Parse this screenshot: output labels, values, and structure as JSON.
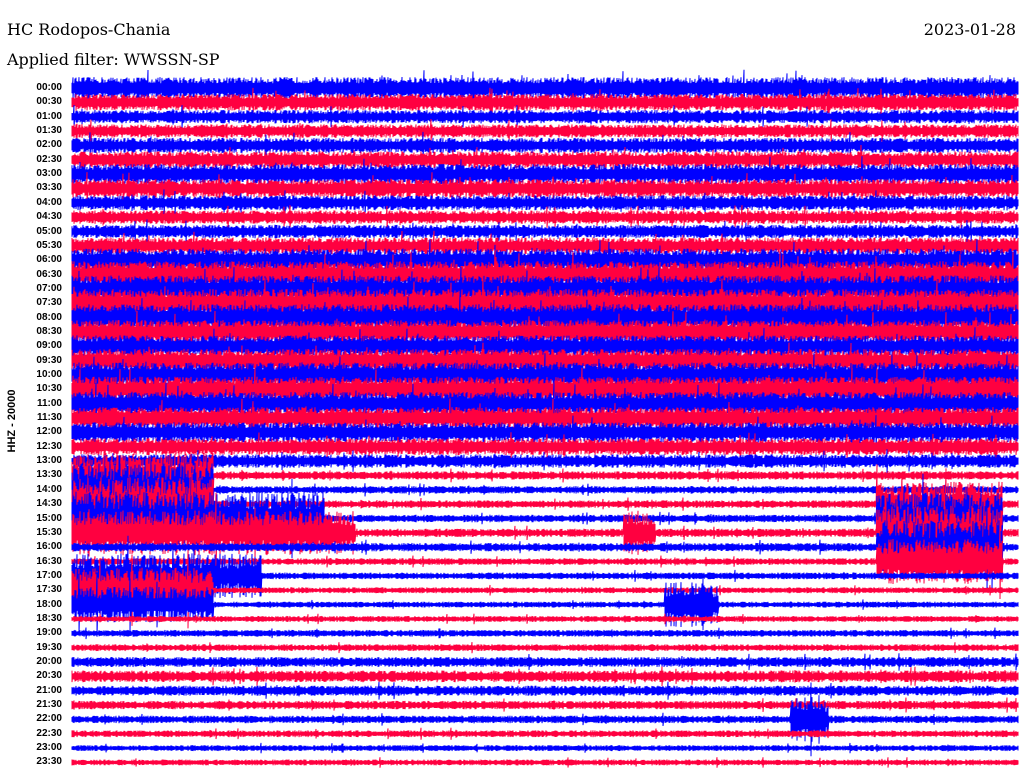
{
  "header": {
    "station": "HC Rodopos-Chania",
    "date": "2023-01-28",
    "filter": "Applied filter: WWSSN-SP"
  },
  "chart_data": {
    "type": "line",
    "title": "HC Rodopos-Chania",
    "ylabel": "HHZ - 20000",
    "xlabel": "",
    "minutes_per_row": 30,
    "series_colors": [
      "#0000ff",
      "#ff0040"
    ],
    "row_labels": [
      "00:00",
      "00:30",
      "01:00",
      "01:30",
      "02:00",
      "02:30",
      "03:00",
      "03:30",
      "04:00",
      "04:30",
      "05:00",
      "05:30",
      "06:00",
      "06:30",
      "07:00",
      "07:30",
      "08:00",
      "08:30",
      "09:00",
      "09:30",
      "10:00",
      "10:30",
      "11:00",
      "11:30",
      "12:00",
      "12:30",
      "13:00",
      "13:30",
      "14:00",
      "14:30",
      "15:00",
      "15:30",
      "16:00",
      "16:30",
      "17:00",
      "17:30",
      "18:00",
      "18:30",
      "19:00",
      "19:30",
      "20:00",
      "20:30",
      "21:00",
      "21:30",
      "22:00",
      "22:30",
      "23:00",
      "23:30"
    ],
    "row_noise_amplitude": [
      1.3,
      1.0,
      0.8,
      0.8,
      0.9,
      1.0,
      1.2,
      1.1,
      0.9,
      0.8,
      0.8,
      1.0,
      1.4,
      1.6,
      1.6,
      1.7,
      1.6,
      1.4,
      1.3,
      1.4,
      1.5,
      1.5,
      1.4,
      1.3,
      1.2,
      1.0,
      0.8,
      0.5,
      0.45,
      0.45,
      0.45,
      0.5,
      0.5,
      0.4,
      0.4,
      0.35,
      0.35,
      0.35,
      0.4,
      0.4,
      0.6,
      0.7,
      0.6,
      0.5,
      0.45,
      0.4,
      0.35,
      0.35
    ],
    "events": [
      {
        "row": 27,
        "start_min": 0,
        "end_min": 4.5,
        "amplitude": 2.5
      },
      {
        "row": 28,
        "start_min": 0,
        "end_min": 4.5,
        "amplitude": 3.0
      },
      {
        "row": 29,
        "start_min": 0,
        "end_min": 4.5,
        "amplitude": 3.0
      },
      {
        "row": 30,
        "start_min": 0,
        "end_min": 8,
        "amplitude": 3.0
      },
      {
        "row": 31,
        "start_min": 0,
        "end_min": 9,
        "amplitude": 2.5
      },
      {
        "row": 34,
        "start_min": 0,
        "end_min": 6,
        "amplitude": 2.5
      },
      {
        "row": 35,
        "start_min": 0,
        "end_min": 4.5,
        "amplitude": 2.5
      },
      {
        "row": 36,
        "start_min": 0,
        "end_min": 4.5,
        "amplitude": 2.0
      },
      {
        "row": 31,
        "start_min": 17.5,
        "end_min": 18.5,
        "amplitude": 2.5
      },
      {
        "row": 36,
        "start_min": 18.8,
        "end_min": 20.5,
        "amplitude": 2.5
      },
      {
        "row": 44,
        "start_min": 22.8,
        "end_min": 24,
        "amplitude": 2.5
      },
      {
        "row": 29,
        "start_min": 25.5,
        "end_min": 29.5,
        "amplitude": 2.5
      },
      {
        "row": 30,
        "start_min": 25.5,
        "end_min": 29.5,
        "amplitude": 3.0
      },
      {
        "row": 31,
        "start_min": 25.5,
        "end_min": 29.5,
        "amplitude": 3.0
      },
      {
        "row": 32,
        "start_min": 25.5,
        "end_min": 29.5,
        "amplitude": 3.0
      },
      {
        "row": 33,
        "start_min": 25.5,
        "end_min": 29.5,
        "amplitude": 2.5
      }
    ]
  }
}
